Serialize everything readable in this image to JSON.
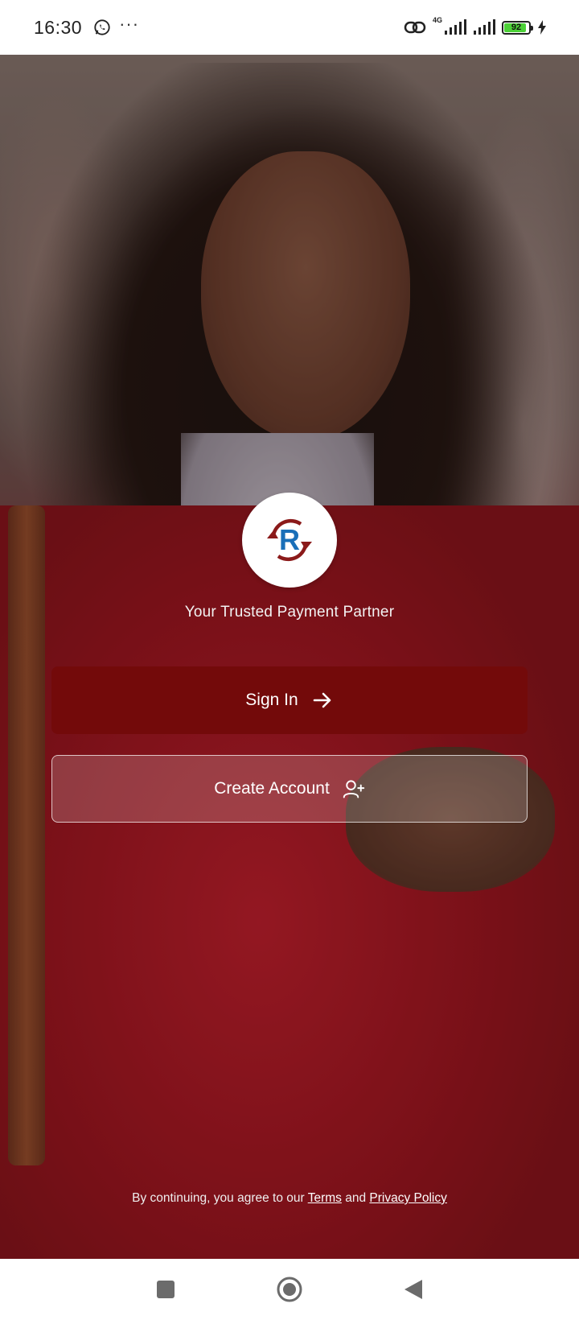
{
  "status_bar": {
    "time": "16:30",
    "notification_icons": [
      "whatsapp-icon",
      "more-dots-icon"
    ],
    "network_type": "4G",
    "battery_level": "92",
    "battery_percent": 92,
    "charging": true
  },
  "hero": {
    "tagline": "Your Trusted Payment Partner",
    "logo_letter": "R"
  },
  "buttons": {
    "sign_in_label": "Sign In",
    "create_account_label": "Create Account"
  },
  "legal": {
    "prefix": "By continuing, you agree to our",
    "terms_label": "Terms",
    "conjunction": "and",
    "privacy_label": "Privacy Policy"
  },
  "nav_bar": {
    "items": [
      "recents-button",
      "home-button",
      "back-button"
    ]
  },
  "colors": {
    "sign_in_bg": "#730a0a",
    "logo_blue": "#1a6fb8",
    "logo_red": "#8b1a1a",
    "battery_green": "#4cd137"
  }
}
